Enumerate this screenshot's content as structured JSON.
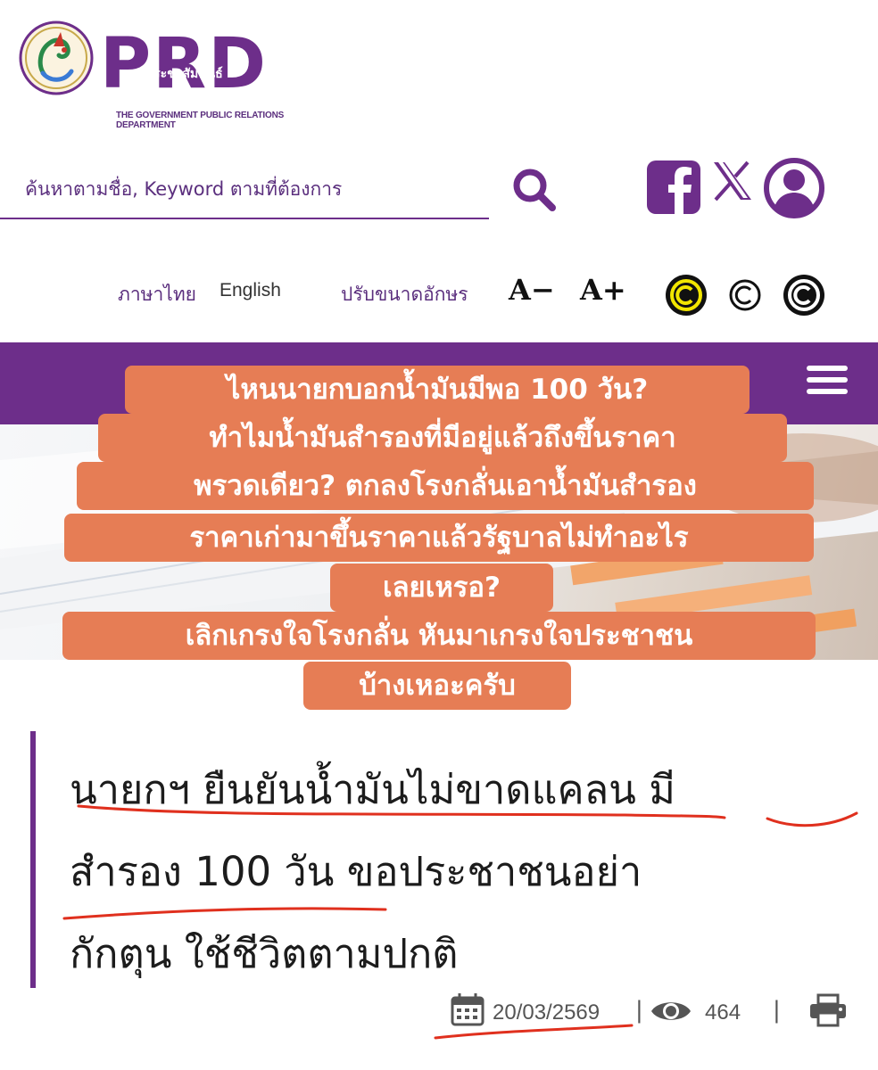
{
  "logo": {
    "brand": "PRD",
    "thai_name": "กรมประชาสัมพันธ์",
    "english_name": "THE GOVERNMENT PUBLIC RELATIONS DEPARTMENT",
    "icon": "naga-emblem-icon"
  },
  "search": {
    "placeholder": "ค้นหาตามชื่อ, Keyword ตามที่ต้องการ",
    "icon": "search-icon"
  },
  "social": {
    "facebook_icon": "facebook-icon",
    "x_icon": "x-icon",
    "user_icon": "user-icon"
  },
  "language": {
    "thai": "ภาษาไทย",
    "english": "English"
  },
  "font_size": {
    "label": "ปรับขนาดอักษร",
    "decrease": "A−",
    "increase": "A+"
  },
  "contrast_options": [
    "yellow-on-black",
    "default",
    "white-on-black"
  ],
  "captions": [
    "ไหนนายกบอกน้ำมันมีพอ 100 วัน?",
    "ทำไมน้ำมันสำรองที่มีอยู่แล้วถึงขึ้นราคา",
    "พรวดเดียว? ตกลงโรงกลั่นเอาน้ำมันสำรอง",
    "ราคาเก่ามาขึ้นราคาแล้วรัฐบาลไม่ทำอะไร",
    "เลยเหรอ?",
    "เลิกเกรงใจโรงกลั่น หันมาเกรงใจประชาชน",
    "บ้างเหอะครับ"
  ],
  "article": {
    "headline_lines": [
      "นายกฯ ยืนยันน้ำมันไม่ขาดแคลน มี",
      "สำรอง 100 วัน ขอประชาชนอย่า",
      "กักตุน ใช้ชีวิตตามปกติ"
    ],
    "date": "20/03/2569",
    "views": "464",
    "separator": "|"
  },
  "colors": {
    "brand_purple": "#6d2e8a",
    "caption_orange": "#e67d55",
    "annotation_red": "#e0301e"
  }
}
